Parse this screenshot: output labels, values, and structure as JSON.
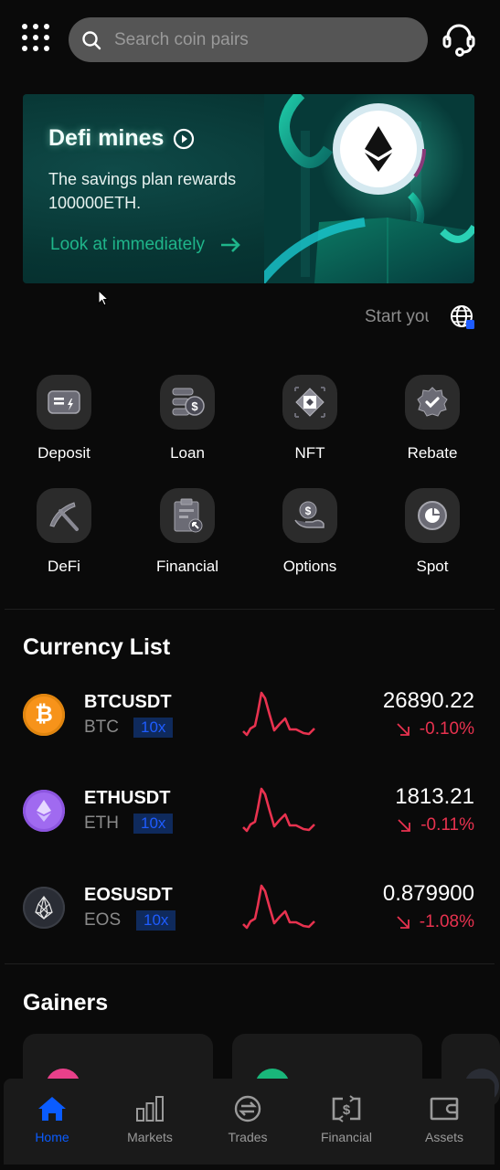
{
  "header": {
    "search_placeholder": "Search coin pairs",
    "menu_icon": "grid-menu-icon",
    "support_icon": "headset-icon"
  },
  "banner": {
    "title": "Defi mines",
    "description": "The savings plan rewards 100000ETH.",
    "link_label": "Look at immediately",
    "accent_color": "#1fb58a"
  },
  "marquee": {
    "text": "Start your",
    "language_icon": "globe-icon"
  },
  "quick_menu": [
    {
      "label": "Deposit",
      "icon": "deposit-icon"
    },
    {
      "label": "Loan",
      "icon": "loan-icon"
    },
    {
      "label": "NFT",
      "icon": "nft-icon"
    },
    {
      "label": "Rebate",
      "icon": "rebate-icon"
    },
    {
      "label": "DeFi",
      "icon": "pickaxe-icon"
    },
    {
      "label": "Financial",
      "icon": "clipboard-icon"
    },
    {
      "label": "Options",
      "icon": "hand-coin-icon"
    },
    {
      "label": "Spot",
      "icon": "pie-chart-icon"
    }
  ],
  "currency_list": {
    "title": "Currency List",
    "items": [
      {
        "pair": "BTCUSDT",
        "base": "BTC",
        "leverage": "10x",
        "price": "26890.22",
        "change": "-0.10%",
        "direction": "down",
        "logo_color": "#f7931a"
      },
      {
        "pair": "ETHUSDT",
        "base": "ETH",
        "leverage": "10x",
        "price": "1813.21",
        "change": "-0.11%",
        "direction": "down",
        "logo_color": "#a06af0"
      },
      {
        "pair": "EOSUSDT",
        "base": "EOS",
        "leverage": "10x",
        "price": "0.879900",
        "change": "-1.08%",
        "direction": "down",
        "logo_color": "#2a2d35"
      }
    ],
    "down_color": "#e8324f"
  },
  "gainers": {
    "title": "Gainers",
    "cards": [
      {
        "logo_color": "#e8408a"
      },
      {
        "logo_color": "#19b77a"
      },
      {
        "logo_color": "#2a2d35"
      }
    ]
  },
  "bottom_nav": {
    "items": [
      {
        "label": "Home",
        "icon": "home-icon",
        "active": true
      },
      {
        "label": "Markets",
        "icon": "bar-chart-icon",
        "active": false
      },
      {
        "label": "Trades",
        "icon": "exchange-icon",
        "active": false
      },
      {
        "label": "Financial",
        "icon": "dollar-exchange-icon",
        "active": false
      },
      {
        "label": "Assets",
        "icon": "wallet-icon",
        "active": false
      }
    ],
    "active_color": "#0a5cff"
  }
}
